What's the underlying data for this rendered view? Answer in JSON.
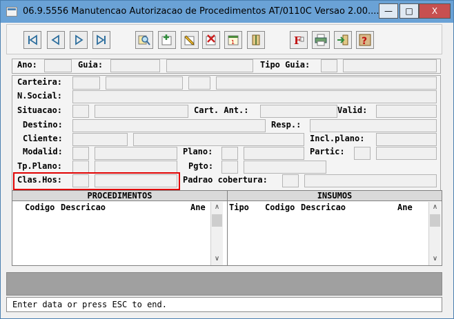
{
  "window": {
    "title": "06.9.5556 Manutencao Autorizacao de Procedimentos AT/0110C Versao 2.00....",
    "controls": {
      "minimize": "—",
      "maximize": "□",
      "close": "X"
    }
  },
  "toolbar": {
    "icons": [
      "first-record-icon",
      "previous-record-icon",
      "next-record-icon",
      "last-record-icon",
      "search-icon",
      "add-icon",
      "edit-icon",
      "delete-icon",
      "calendar-icon",
      "exit-door-icon",
      "function-icon",
      "print-icon",
      "export-icon",
      "help-icon"
    ],
    "f_glyph": "F",
    "help_glyph": "?"
  },
  "header": {
    "ano_label": "Ano:",
    "guia_label": "Guia:",
    "tipo_guia_label": "Tipo Guia:"
  },
  "form": {
    "carteira_label": "Carteira:",
    "nsocial_label": "N.Social:",
    "situacao_label": "Situacao:",
    "cart_ant_label": "Cart. Ant.:",
    "valid_label": "Valid:",
    "destino_label": "Destino:",
    "resp_label": "Resp.:",
    "cliente_label": "Cliente:",
    "incl_plano_label": "Incl.plano:",
    "modalid_label": "Modalid:",
    "plano_label": "Plano:",
    "partic_label": "Partic:",
    "tp_plano_label": "Tp.Plano:",
    "pgto_label": "Pgto:",
    "clas_hos_label": "Clas.Hos:",
    "padrao_cobertura_label": "Padrao cobertura:"
  },
  "procedimentos": {
    "title": "PROCEDIMENTOS",
    "columns": [
      "Codigo",
      "Descricao",
      "Ane"
    ]
  },
  "insumos": {
    "title": "INSUMOS",
    "columns": [
      "Tipo",
      "Codigo",
      "Descricao",
      "Ane"
    ]
  },
  "status": {
    "message": "Enter data or press ESC to end."
  },
  "colors": {
    "titlebar": "#6aa2d6",
    "highlight": "#e00000",
    "close_button": "#c75050"
  }
}
